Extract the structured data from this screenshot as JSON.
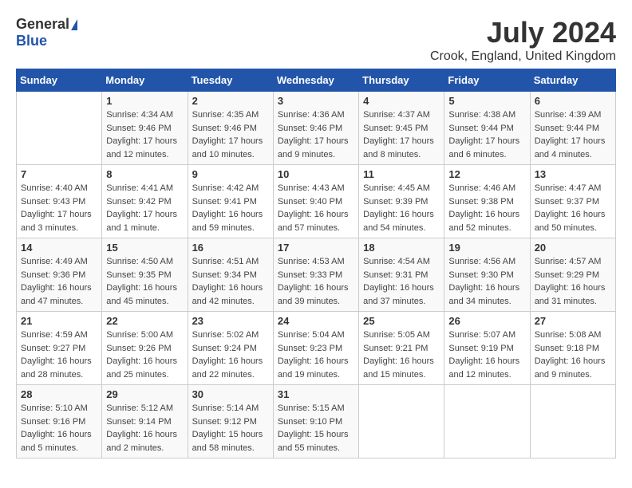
{
  "header": {
    "logo_general": "General",
    "logo_blue": "Blue",
    "month": "July 2024",
    "location": "Crook, England, United Kingdom"
  },
  "days_of_week": [
    "Sunday",
    "Monday",
    "Tuesday",
    "Wednesday",
    "Thursday",
    "Friday",
    "Saturday"
  ],
  "weeks": [
    [
      {
        "day": "",
        "sunrise": "",
        "sunset": "",
        "daylight": ""
      },
      {
        "day": "1",
        "sunrise": "Sunrise: 4:34 AM",
        "sunset": "Sunset: 9:46 PM",
        "daylight": "Daylight: 17 hours and 12 minutes."
      },
      {
        "day": "2",
        "sunrise": "Sunrise: 4:35 AM",
        "sunset": "Sunset: 9:46 PM",
        "daylight": "Daylight: 17 hours and 10 minutes."
      },
      {
        "day": "3",
        "sunrise": "Sunrise: 4:36 AM",
        "sunset": "Sunset: 9:46 PM",
        "daylight": "Daylight: 17 hours and 9 minutes."
      },
      {
        "day": "4",
        "sunrise": "Sunrise: 4:37 AM",
        "sunset": "Sunset: 9:45 PM",
        "daylight": "Daylight: 17 hours and 8 minutes."
      },
      {
        "day": "5",
        "sunrise": "Sunrise: 4:38 AM",
        "sunset": "Sunset: 9:44 PM",
        "daylight": "Daylight: 17 hours and 6 minutes."
      },
      {
        "day": "6",
        "sunrise": "Sunrise: 4:39 AM",
        "sunset": "Sunset: 9:44 PM",
        "daylight": "Daylight: 17 hours and 4 minutes."
      }
    ],
    [
      {
        "day": "7",
        "sunrise": "Sunrise: 4:40 AM",
        "sunset": "Sunset: 9:43 PM",
        "daylight": "Daylight: 17 hours and 3 minutes."
      },
      {
        "day": "8",
        "sunrise": "Sunrise: 4:41 AM",
        "sunset": "Sunset: 9:42 PM",
        "daylight": "Daylight: 17 hours and 1 minute."
      },
      {
        "day": "9",
        "sunrise": "Sunrise: 4:42 AM",
        "sunset": "Sunset: 9:41 PM",
        "daylight": "Daylight: 16 hours and 59 minutes."
      },
      {
        "day": "10",
        "sunrise": "Sunrise: 4:43 AM",
        "sunset": "Sunset: 9:40 PM",
        "daylight": "Daylight: 16 hours and 57 minutes."
      },
      {
        "day": "11",
        "sunrise": "Sunrise: 4:45 AM",
        "sunset": "Sunset: 9:39 PM",
        "daylight": "Daylight: 16 hours and 54 minutes."
      },
      {
        "day": "12",
        "sunrise": "Sunrise: 4:46 AM",
        "sunset": "Sunset: 9:38 PM",
        "daylight": "Daylight: 16 hours and 52 minutes."
      },
      {
        "day": "13",
        "sunrise": "Sunrise: 4:47 AM",
        "sunset": "Sunset: 9:37 PM",
        "daylight": "Daylight: 16 hours and 50 minutes."
      }
    ],
    [
      {
        "day": "14",
        "sunrise": "Sunrise: 4:49 AM",
        "sunset": "Sunset: 9:36 PM",
        "daylight": "Daylight: 16 hours and 47 minutes."
      },
      {
        "day": "15",
        "sunrise": "Sunrise: 4:50 AM",
        "sunset": "Sunset: 9:35 PM",
        "daylight": "Daylight: 16 hours and 45 minutes."
      },
      {
        "day": "16",
        "sunrise": "Sunrise: 4:51 AM",
        "sunset": "Sunset: 9:34 PM",
        "daylight": "Daylight: 16 hours and 42 minutes."
      },
      {
        "day": "17",
        "sunrise": "Sunrise: 4:53 AM",
        "sunset": "Sunset: 9:33 PM",
        "daylight": "Daylight: 16 hours and 39 minutes."
      },
      {
        "day": "18",
        "sunrise": "Sunrise: 4:54 AM",
        "sunset": "Sunset: 9:31 PM",
        "daylight": "Daylight: 16 hours and 37 minutes."
      },
      {
        "day": "19",
        "sunrise": "Sunrise: 4:56 AM",
        "sunset": "Sunset: 9:30 PM",
        "daylight": "Daylight: 16 hours and 34 minutes."
      },
      {
        "day": "20",
        "sunrise": "Sunrise: 4:57 AM",
        "sunset": "Sunset: 9:29 PM",
        "daylight": "Daylight: 16 hours and 31 minutes."
      }
    ],
    [
      {
        "day": "21",
        "sunrise": "Sunrise: 4:59 AM",
        "sunset": "Sunset: 9:27 PM",
        "daylight": "Daylight: 16 hours and 28 minutes."
      },
      {
        "day": "22",
        "sunrise": "Sunrise: 5:00 AM",
        "sunset": "Sunset: 9:26 PM",
        "daylight": "Daylight: 16 hours and 25 minutes."
      },
      {
        "day": "23",
        "sunrise": "Sunrise: 5:02 AM",
        "sunset": "Sunset: 9:24 PM",
        "daylight": "Daylight: 16 hours and 22 minutes."
      },
      {
        "day": "24",
        "sunrise": "Sunrise: 5:04 AM",
        "sunset": "Sunset: 9:23 PM",
        "daylight": "Daylight: 16 hours and 19 minutes."
      },
      {
        "day": "25",
        "sunrise": "Sunrise: 5:05 AM",
        "sunset": "Sunset: 9:21 PM",
        "daylight": "Daylight: 16 hours and 15 minutes."
      },
      {
        "day": "26",
        "sunrise": "Sunrise: 5:07 AM",
        "sunset": "Sunset: 9:19 PM",
        "daylight": "Daylight: 16 hours and 12 minutes."
      },
      {
        "day": "27",
        "sunrise": "Sunrise: 5:08 AM",
        "sunset": "Sunset: 9:18 PM",
        "daylight": "Daylight: 16 hours and 9 minutes."
      }
    ],
    [
      {
        "day": "28",
        "sunrise": "Sunrise: 5:10 AM",
        "sunset": "Sunset: 9:16 PM",
        "daylight": "Daylight: 16 hours and 5 minutes."
      },
      {
        "day": "29",
        "sunrise": "Sunrise: 5:12 AM",
        "sunset": "Sunset: 9:14 PM",
        "daylight": "Daylight: 16 hours and 2 minutes."
      },
      {
        "day": "30",
        "sunrise": "Sunrise: 5:14 AM",
        "sunset": "Sunset: 9:12 PM",
        "daylight": "Daylight: 15 hours and 58 minutes."
      },
      {
        "day": "31",
        "sunrise": "Sunrise: 5:15 AM",
        "sunset": "Sunset: 9:10 PM",
        "daylight": "Daylight: 15 hours and 55 minutes."
      },
      {
        "day": "",
        "sunrise": "",
        "sunset": "",
        "daylight": ""
      },
      {
        "day": "",
        "sunrise": "",
        "sunset": "",
        "daylight": ""
      },
      {
        "day": "",
        "sunrise": "",
        "sunset": "",
        "daylight": ""
      }
    ]
  ]
}
